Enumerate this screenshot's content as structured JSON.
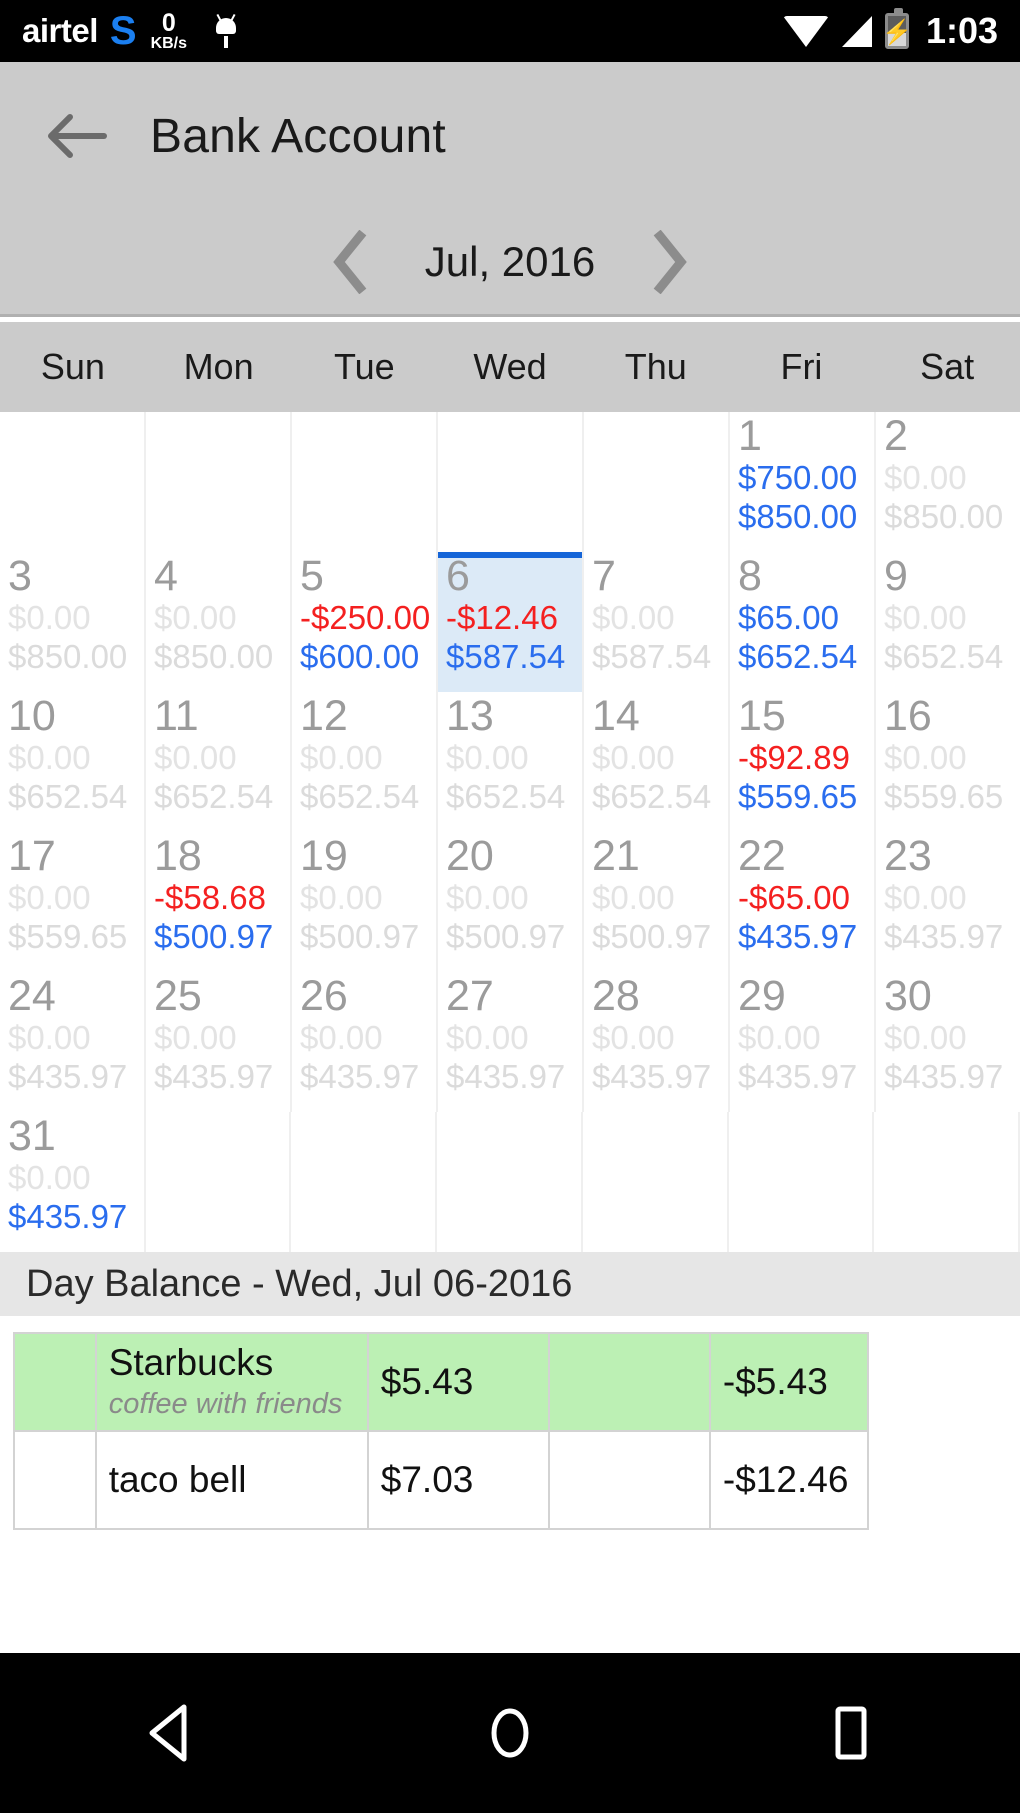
{
  "status_bar": {
    "carrier": "airtel",
    "logo_glyph": "S",
    "net_speed_value": "0",
    "net_speed_unit": "KB/s",
    "android_icon": "android-bug-icon",
    "wifi_icon": "wifi-icon",
    "signal_icon": "signal-icon",
    "battery_icon": "battery-charging-icon",
    "time": "1:03"
  },
  "app_bar": {
    "back_icon": "back-arrow-icon",
    "title": "Bank Account"
  },
  "month_nav": {
    "prev_icon": "chevron-left-icon",
    "next_icon": "chevron-right-icon",
    "label": "Jul, 2016"
  },
  "weekdays": [
    "Sun",
    "Mon",
    "Tue",
    "Wed",
    "Thu",
    "Fri",
    "Sat"
  ],
  "calendar": {
    "selected_day": "6",
    "weeks": [
      [
        {
          "day": "",
          "change": "",
          "balance": "",
          "empty": true
        },
        {
          "day": "",
          "change": "",
          "balance": "",
          "empty": true
        },
        {
          "day": "",
          "change": "",
          "balance": "",
          "empty": true
        },
        {
          "day": "",
          "change": "",
          "balance": "",
          "empty": true
        },
        {
          "day": "",
          "change": "",
          "balance": "",
          "empty": true
        },
        {
          "day": "1",
          "change": "$750.00",
          "balance": "$850.00",
          "change_kind": "pos",
          "balance_kind": "bal"
        },
        {
          "day": "2",
          "change": "$0.00",
          "balance": "$850.00",
          "change_kind": "zero",
          "balance_kind": "dim-bal"
        }
      ],
      [
        {
          "day": "3",
          "change": "$0.00",
          "balance": "$850.00",
          "change_kind": "zero",
          "balance_kind": "dim-bal"
        },
        {
          "day": "4",
          "change": "$0.00",
          "balance": "$850.00",
          "change_kind": "zero",
          "balance_kind": "dim-bal"
        },
        {
          "day": "5",
          "change": "-$250.00",
          "balance": "$600.00",
          "change_kind": "neg",
          "balance_kind": "bal"
        },
        {
          "day": "6",
          "change": "-$12.46",
          "balance": "$587.54",
          "change_kind": "neg",
          "balance_kind": "bal",
          "selected": true
        },
        {
          "day": "7",
          "change": "$0.00",
          "balance": "$587.54",
          "change_kind": "zero",
          "balance_kind": "dim-bal"
        },
        {
          "day": "8",
          "change": "$65.00",
          "balance": "$652.54",
          "change_kind": "pos",
          "balance_kind": "bal"
        },
        {
          "day": "9",
          "change": "$0.00",
          "balance": "$652.54",
          "change_kind": "zero",
          "balance_kind": "dim-bal"
        }
      ],
      [
        {
          "day": "10",
          "change": "$0.00",
          "balance": "$652.54",
          "change_kind": "zero",
          "balance_kind": "dim-bal"
        },
        {
          "day": "11",
          "change": "$0.00",
          "balance": "$652.54",
          "change_kind": "zero",
          "balance_kind": "dim-bal"
        },
        {
          "day": "12",
          "change": "$0.00",
          "balance": "$652.54",
          "change_kind": "zero",
          "balance_kind": "dim-bal"
        },
        {
          "day": "13",
          "change": "$0.00",
          "balance": "$652.54",
          "change_kind": "zero",
          "balance_kind": "dim-bal"
        },
        {
          "day": "14",
          "change": "$0.00",
          "balance": "$652.54",
          "change_kind": "zero",
          "balance_kind": "dim-bal"
        },
        {
          "day": "15",
          "change": "-$92.89",
          "balance": "$559.65",
          "change_kind": "neg",
          "balance_kind": "bal"
        },
        {
          "day": "16",
          "change": "$0.00",
          "balance": "$559.65",
          "change_kind": "zero",
          "balance_kind": "dim-bal"
        }
      ],
      [
        {
          "day": "17",
          "change": "$0.00",
          "balance": "$559.65",
          "change_kind": "zero",
          "balance_kind": "dim-bal"
        },
        {
          "day": "18",
          "change": "-$58.68",
          "balance": "$500.97",
          "change_kind": "neg",
          "balance_kind": "bal"
        },
        {
          "day": "19",
          "change": "$0.00",
          "balance": "$500.97",
          "change_kind": "zero",
          "balance_kind": "dim-bal"
        },
        {
          "day": "20",
          "change": "$0.00",
          "balance": "$500.97",
          "change_kind": "zero",
          "balance_kind": "dim-bal"
        },
        {
          "day": "21",
          "change": "$0.00",
          "balance": "$500.97",
          "change_kind": "zero",
          "balance_kind": "dim-bal"
        },
        {
          "day": "22",
          "change": "-$65.00",
          "balance": "$435.97",
          "change_kind": "neg",
          "balance_kind": "bal"
        },
        {
          "day": "23",
          "change": "$0.00",
          "balance": "$435.97",
          "change_kind": "zero",
          "balance_kind": "dim-bal"
        }
      ],
      [
        {
          "day": "24",
          "change": "$0.00",
          "balance": "$435.97",
          "change_kind": "zero",
          "balance_kind": "dim-bal"
        },
        {
          "day": "25",
          "change": "$0.00",
          "balance": "$435.97",
          "change_kind": "zero",
          "balance_kind": "dim-bal"
        },
        {
          "day": "26",
          "change": "$0.00",
          "balance": "$435.97",
          "change_kind": "zero",
          "balance_kind": "dim-bal"
        },
        {
          "day": "27",
          "change": "$0.00",
          "balance": "$435.97",
          "change_kind": "zero",
          "balance_kind": "dim-bal"
        },
        {
          "day": "28",
          "change": "$0.00",
          "balance": "$435.97",
          "change_kind": "zero",
          "balance_kind": "dim-bal"
        },
        {
          "day": "29",
          "change": "$0.00",
          "balance": "$435.97",
          "change_kind": "zero",
          "balance_kind": "dim-bal"
        },
        {
          "day": "30",
          "change": "$0.00",
          "balance": "$435.97",
          "change_kind": "zero",
          "balance_kind": "dim-bal"
        }
      ],
      [
        {
          "day": "31",
          "change": "$0.00",
          "balance": "$435.97",
          "change_kind": "zero",
          "balance_kind": "bal"
        },
        {
          "day": "",
          "change": "",
          "balance": "",
          "empty": true
        },
        {
          "day": "",
          "change": "",
          "balance": "",
          "empty": true
        },
        {
          "day": "",
          "change": "",
          "balance": "",
          "empty": true
        },
        {
          "day": "",
          "change": "",
          "balance": "",
          "empty": true
        },
        {
          "day": "",
          "change": "",
          "balance": "",
          "empty": true
        },
        {
          "day": "",
          "change": "",
          "balance": "",
          "empty": true
        }
      ]
    ]
  },
  "day_balance": {
    "title": "Day Balance - Wed, Jul 06-2016"
  },
  "transactions": {
    "rows": [
      {
        "icon": "",
        "name": "Starbucks",
        "note": "coffee with friends",
        "amount": "$5.43",
        "middle": "",
        "running_total": "-$5.43",
        "highlight": true
      },
      {
        "icon": "",
        "name": "taco bell",
        "note": "",
        "amount": "$7.03",
        "middle": "",
        "running_total": "-$12.46",
        "highlight": false
      }
    ]
  },
  "nav_bar": {
    "back_icon": "nav-back-triangle-icon",
    "home_icon": "nav-home-circle-icon",
    "recents_icon": "nav-recents-square-icon"
  },
  "colors": {
    "accent_blue": "#2a6dee",
    "negative_red": "#f42020",
    "selected_cell": "#dceaf7",
    "selected_border": "#1565d8",
    "highlight_green": "#bcf0b4",
    "chrome_gray": "#cbcbcb"
  }
}
